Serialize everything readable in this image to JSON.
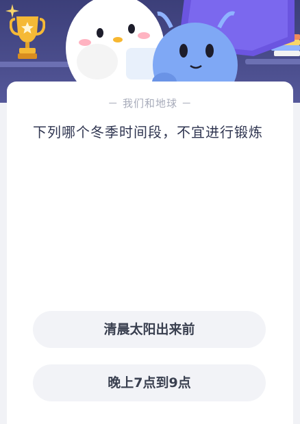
{
  "header": {
    "icons": [
      "sparkle-icon",
      "trophy-icon",
      "books-icon"
    ],
    "colors": {
      "banner": "#3c3f79",
      "mascot_white": "#ffffff",
      "mascot_blue": "#7fa8f5",
      "trophy": "#f5b936"
    }
  },
  "quiz": {
    "source": "－ 我们和地球 －",
    "question": "下列哪个冬季时间段，不宜进行锻炼",
    "options": [
      {
        "label": "清晨太阳出来前"
      },
      {
        "label": "晚上7点到9点"
      }
    ]
  },
  "colors": {
    "page_bg": "#f1f2f6",
    "card_bg": "#ffffff",
    "option_bg": "#f2f3f7",
    "question_text": "#2f3550",
    "source_text": "#a7abba"
  }
}
